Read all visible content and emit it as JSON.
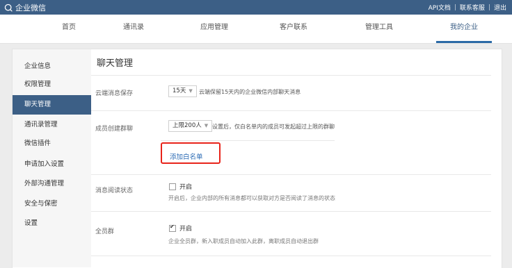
{
  "topbar": {
    "brand": "企业微信",
    "links": [
      "API文档",
      "联系客服",
      "退出"
    ]
  },
  "nav": {
    "tabs": [
      "首页",
      "通讯录",
      "应用管理",
      "客户联系",
      "管理工具",
      "我的企业"
    ],
    "active": "我的企业"
  },
  "sidebar": {
    "items": [
      "企业信息",
      "权限管理",
      "聊天管理",
      "通讯录管理",
      "微信插件",
      "申请加入设置",
      "外部沟通管理",
      "安全与保密",
      "设置"
    ],
    "active": "聊天管理"
  },
  "page": {
    "title": "聊天管理",
    "cloud_storage": {
      "label": "云端消息保存",
      "value": "15天",
      "hint": "云端保留15天内的企业微信内部聊天消息"
    },
    "group_create": {
      "label": "成员创建群聊",
      "value": "上限200人",
      "hint": "设置后，仅白名单内的成员可发起超过上限的群聊",
      "whitelist_link": "添加白名单"
    },
    "read_status": {
      "label": "消息阅读状态",
      "option": "开启",
      "checked": false,
      "desc": "开启后，企业内部的所有消息都可以获取对方是否阅读了消息的状态"
    },
    "all_staff_group": {
      "label": "全员群",
      "option": "开启",
      "checked": true,
      "desc": "企业全员群，新入职成员自动加入此群，离职成员自动退出群"
    }
  },
  "colors": {
    "brand": "#3c5f86",
    "link": "#2d6cb5",
    "highlight": "#e8231a"
  }
}
